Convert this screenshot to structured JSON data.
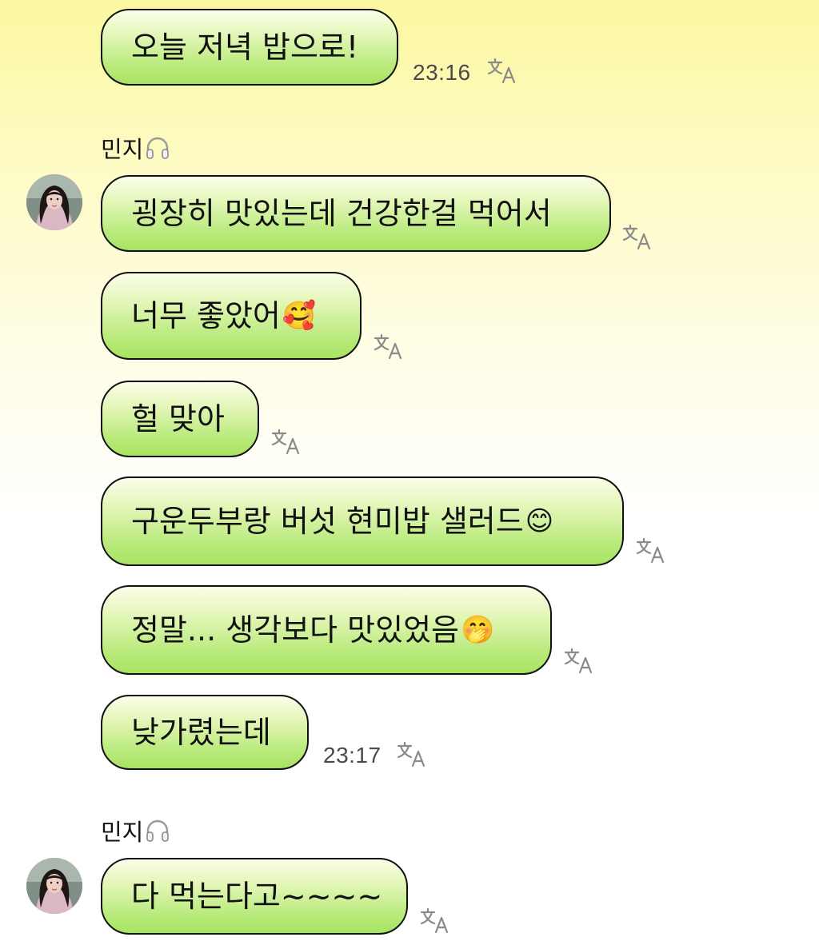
{
  "messages": [
    {
      "text": "오늘 저녁 밥으로!",
      "emoji": "",
      "time": "23:16"
    },
    {
      "text": "굉장히 맛있는데 건강한걸 먹어서",
      "emoji": "",
      "time": ""
    },
    {
      "text": "너무 좋았어",
      "emoji": "🥰",
      "time": ""
    },
    {
      "text": "헐 맞아",
      "emoji": "",
      "time": ""
    },
    {
      "text": "구운두부랑 버섯 현미밥 샐러드",
      "emoji": "😊",
      "time": ""
    },
    {
      "text": "정말... 생각보다 맛있었음",
      "emoji": "🤭",
      "time": ""
    },
    {
      "text": "낮가렸는데",
      "emoji": "",
      "time": "23:17"
    },
    {
      "text": "다 먹는다고~~~~",
      "emoji": "",
      "time": ""
    }
  ],
  "senders": [
    {
      "name": "민지"
    },
    {
      "name": "민지"
    }
  ],
  "icons": {
    "translate": "translate-icon",
    "headphones": "headphones-icon"
  },
  "colors": {
    "bubble_top": "#fbfde8",
    "bubble_bottom": "#a8e463",
    "background_top": "#fbf7a0",
    "border": "#111111"
  }
}
